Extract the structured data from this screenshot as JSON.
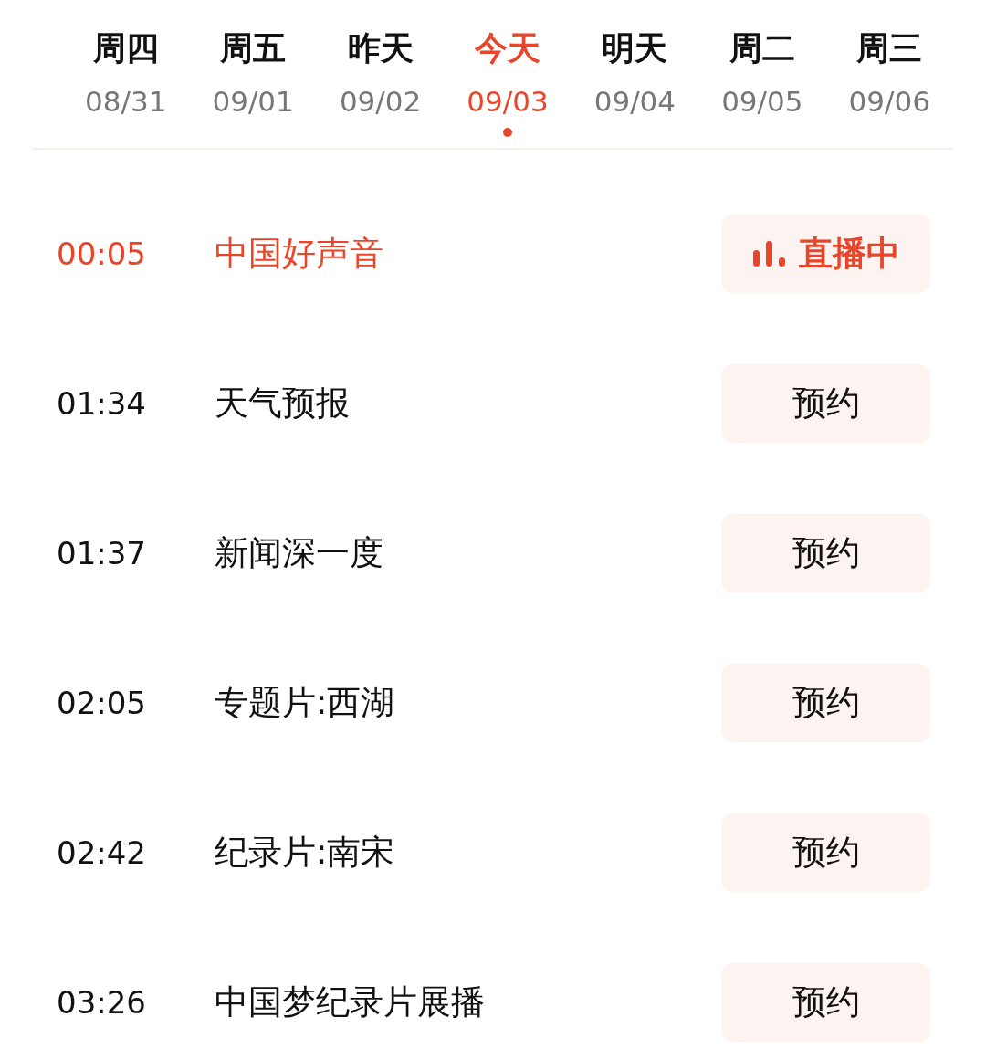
{
  "days": [
    {
      "day": "周四",
      "date": "08/31",
      "selected": false
    },
    {
      "day": "周五",
      "date": "09/01",
      "selected": false
    },
    {
      "day": "昨天",
      "date": "09/02",
      "selected": false
    },
    {
      "day": "今天",
      "date": "09/03",
      "selected": true
    },
    {
      "day": "明天",
      "date": "09/04",
      "selected": false
    },
    {
      "day": "周二",
      "date": "09/05",
      "selected": false
    },
    {
      "day": "周三",
      "date": "09/06",
      "selected": false
    }
  ],
  "programs": [
    {
      "time": "00:05",
      "title": "中国好声音",
      "live": true,
      "button": "直播中"
    },
    {
      "time": "01:34",
      "title": "天气预报",
      "live": false,
      "button": "预约"
    },
    {
      "time": "01:37",
      "title": "新闻深一度",
      "live": false,
      "button": "预约"
    },
    {
      "time": "02:05",
      "title": "专题片:西湖",
      "live": false,
      "button": "预约"
    },
    {
      "time": "02:42",
      "title": "纪录片:南宋",
      "live": false,
      "button": "预约"
    },
    {
      "time": "03:26",
      "title": "中国梦纪录片展播",
      "live": false,
      "button": "预约"
    }
  ]
}
